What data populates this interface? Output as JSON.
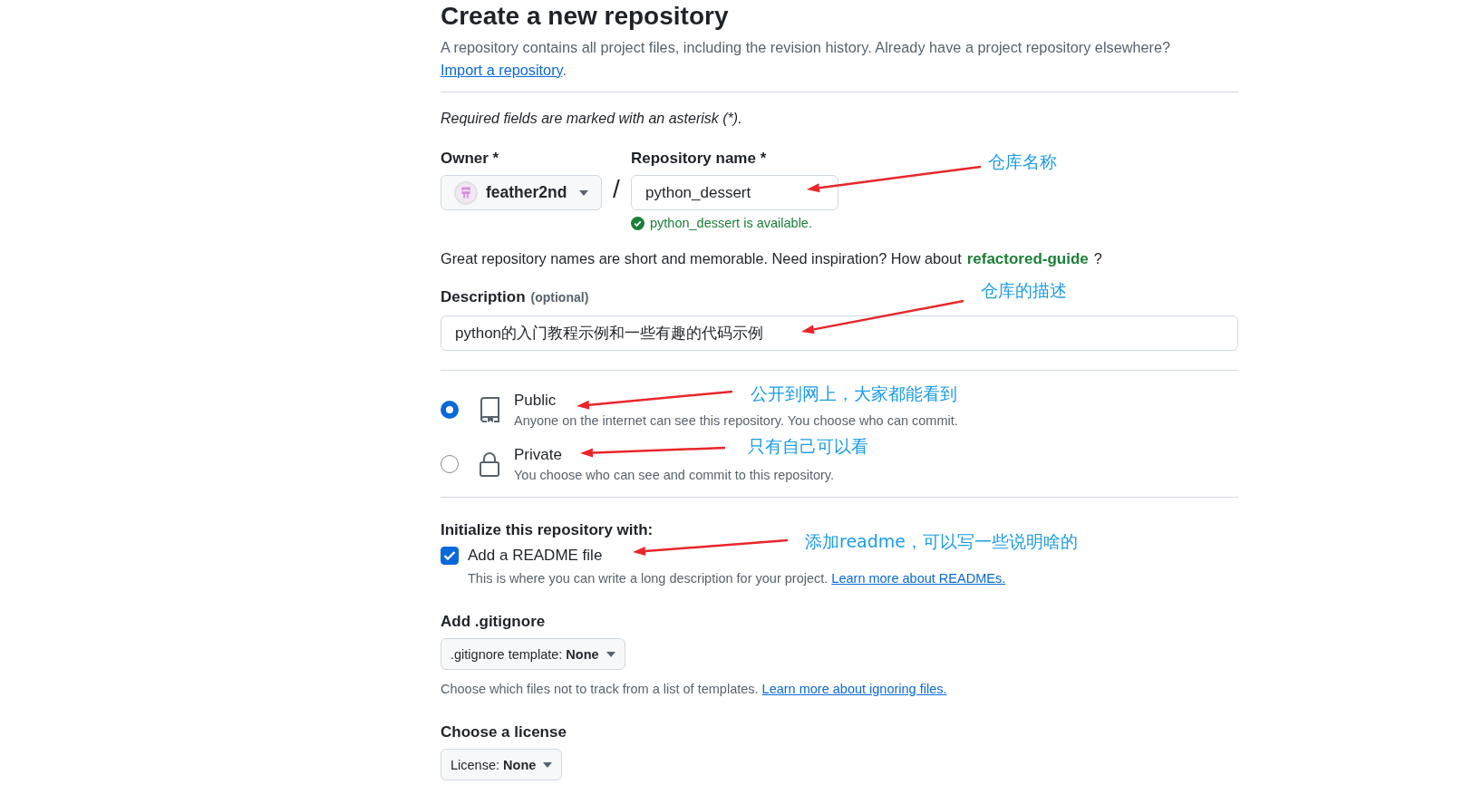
{
  "header": {
    "title": "Create a new repository",
    "intro": "A repository contains all project files, including the revision history. Already have a project repository elsewhere?",
    "import_link": "Import a repository",
    "intro_end": "."
  },
  "required_note": "Required fields are marked with an asterisk (*).",
  "owner": {
    "label": "Owner *",
    "value": "feather2nd"
  },
  "separator": "/",
  "repo_name": {
    "label": "Repository name *",
    "value": "python_dessert",
    "status": "python_dessert is available."
  },
  "suggestion": {
    "text": "Great repository names are short and memorable. Need inspiration? How about",
    "name": "refactored-guide",
    "end": "?"
  },
  "description": {
    "label": "Description",
    "hint": "(optional)",
    "value": "python的入门教程示例和一些有趣的代码示例"
  },
  "visibility": [
    {
      "kind": "public",
      "title": "Public",
      "text": "Anyone on the internet can see this repository. You choose who can commit.",
      "selected": true
    },
    {
      "kind": "private",
      "title": "Private",
      "text": "You choose who can see and commit to this repository.",
      "selected": false
    }
  ],
  "initialize": {
    "heading": "Initialize this repository with:",
    "readme": {
      "label": "Add a README file",
      "checked": true,
      "text": "This is where you can write a long description for your project.",
      "link": "Learn more about READMEs."
    }
  },
  "gitignore": {
    "heading": "Add .gitignore",
    "button": ".gitignore template: **None**",
    "text": "Choose which files not to track from a list of templates.",
    "link": "Learn more about ignoring files."
  },
  "license": {
    "heading": "Choose a license",
    "button": "License: **None**"
  },
  "annotations": [
    {
      "text": "仓库名称"
    },
    {
      "text": "仓库的描述"
    },
    {
      "text": "公开到网上，大家都能看到"
    },
    {
      "text": "只有自己可以看"
    },
    {
      "text": "添加readme，可以写一些说明啥的"
    }
  ]
}
